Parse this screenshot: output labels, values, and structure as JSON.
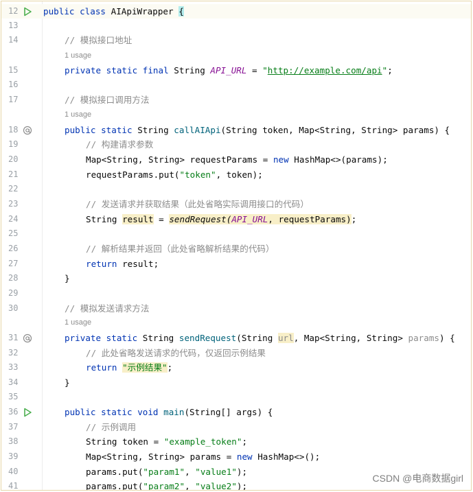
{
  "editor": {
    "lines": [
      {
        "num": "12",
        "icon": "run"
      },
      {
        "num": "13"
      },
      {
        "num": "14"
      },
      {
        "num": "15"
      },
      {
        "num": "16"
      },
      {
        "num": "17"
      },
      {
        "num": "18",
        "icon": "override"
      },
      {
        "num": "19"
      },
      {
        "num": "20"
      },
      {
        "num": "21"
      },
      {
        "num": "22"
      },
      {
        "num": "23"
      },
      {
        "num": "24"
      },
      {
        "num": "25"
      },
      {
        "num": "26"
      },
      {
        "num": "27"
      },
      {
        "num": "28"
      },
      {
        "num": "29"
      },
      {
        "num": "30"
      },
      {
        "num": "31",
        "icon": "override"
      },
      {
        "num": "32"
      },
      {
        "num": "33"
      },
      {
        "num": "34"
      },
      {
        "num": "35"
      },
      {
        "num": "36",
        "icon": "run"
      },
      {
        "num": "37"
      },
      {
        "num": "38"
      },
      {
        "num": "39"
      },
      {
        "num": "40"
      },
      {
        "num": "41"
      }
    ],
    "inlay_usage": "1 usage",
    "code": {
      "kw_public": "public",
      "kw_class": "class",
      "kw_private": "private",
      "kw_static": "static",
      "kw_final": "final",
      "kw_new": "new",
      "kw_return": "return",
      "kw_void": "void",
      "class_name": "AIApiWrapper",
      "open_brace": "{",
      "close_brace": "}",
      "c14": "// 模拟接口地址",
      "l15_type": "String",
      "l15_const": "API_URL",
      "l15_eq": " = ",
      "l15_q1": "\"",
      "l15_url": "http://example.com/api",
      "l15_q2": "\"",
      "l15_end": ";",
      "c17": "// 模拟接口调用方法",
      "l18_type": "String",
      "l18_fn": "callAIApi",
      "l18_params": "(String token, Map<String, String> params) {",
      "c19": "// 构建请求参数",
      "l20_a": "Map<String, String> requestParams = ",
      "l20_b": " HashMap<>(params);",
      "l21_a": "requestParams.put(",
      "l21_str": "\"token\"",
      "l21_b": ", token);",
      "c23": "// 发送请求并获取结果（此处省略实际调用接口的代码）",
      "l24_type": "String ",
      "l24_var": "result",
      "l24_eq": " = ",
      "l24_call": "sendRequest(",
      "l24_const": "API_URL",
      "l24_args": ", requestParams)",
      "l24_end": ";",
      "c26": "// 解析结果并返回（此处省略解析结果的代码）",
      "l27_rest": " result;",
      "c30": "// 模拟发送请求方法",
      "l31_type": "String",
      "l31_fn": "sendRequest",
      "l31_open": "(String ",
      "l31_url": "url",
      "l31_mid": ", Map<String, String> ",
      "l31_params": "params",
      "l31_end": ") {",
      "c32": "// 此处省略发送请求的代码，仅返回示例结果",
      "l33_str": "\"示例结果\"",
      "l33_end": ";",
      "l36_fn": "main",
      "l36_params": "(String[] args) {",
      "c37": "// 示例调用",
      "l38_a": "String token = ",
      "l38_str": "\"example_token\"",
      "l38_end": ";",
      "l39_a": "Map<String, String> params = ",
      "l39_b": " HashMap<>();",
      "l40_a": "params.put(",
      "l40_s1": "\"param1\"",
      "l40_c": ", ",
      "l40_s2": "\"value1\"",
      "l40_end": ");",
      "l41_a": "params.put(",
      "l41_s1": "\"param2\"",
      "l41_c": ", ",
      "l41_s2": "\"value2\"",
      "l41_end": ");"
    }
  },
  "watermark": "CSDN @电商数据girl",
  "colors": {
    "keyword": "#0033b3",
    "string": "#067d17",
    "comment": "#8c8c8c",
    "method": "#00627a",
    "constant": "#871094",
    "run_icon": "#4caf50"
  },
  "icons": {
    "run": "run-gutter-icon",
    "override": "at-gutter-icon"
  }
}
